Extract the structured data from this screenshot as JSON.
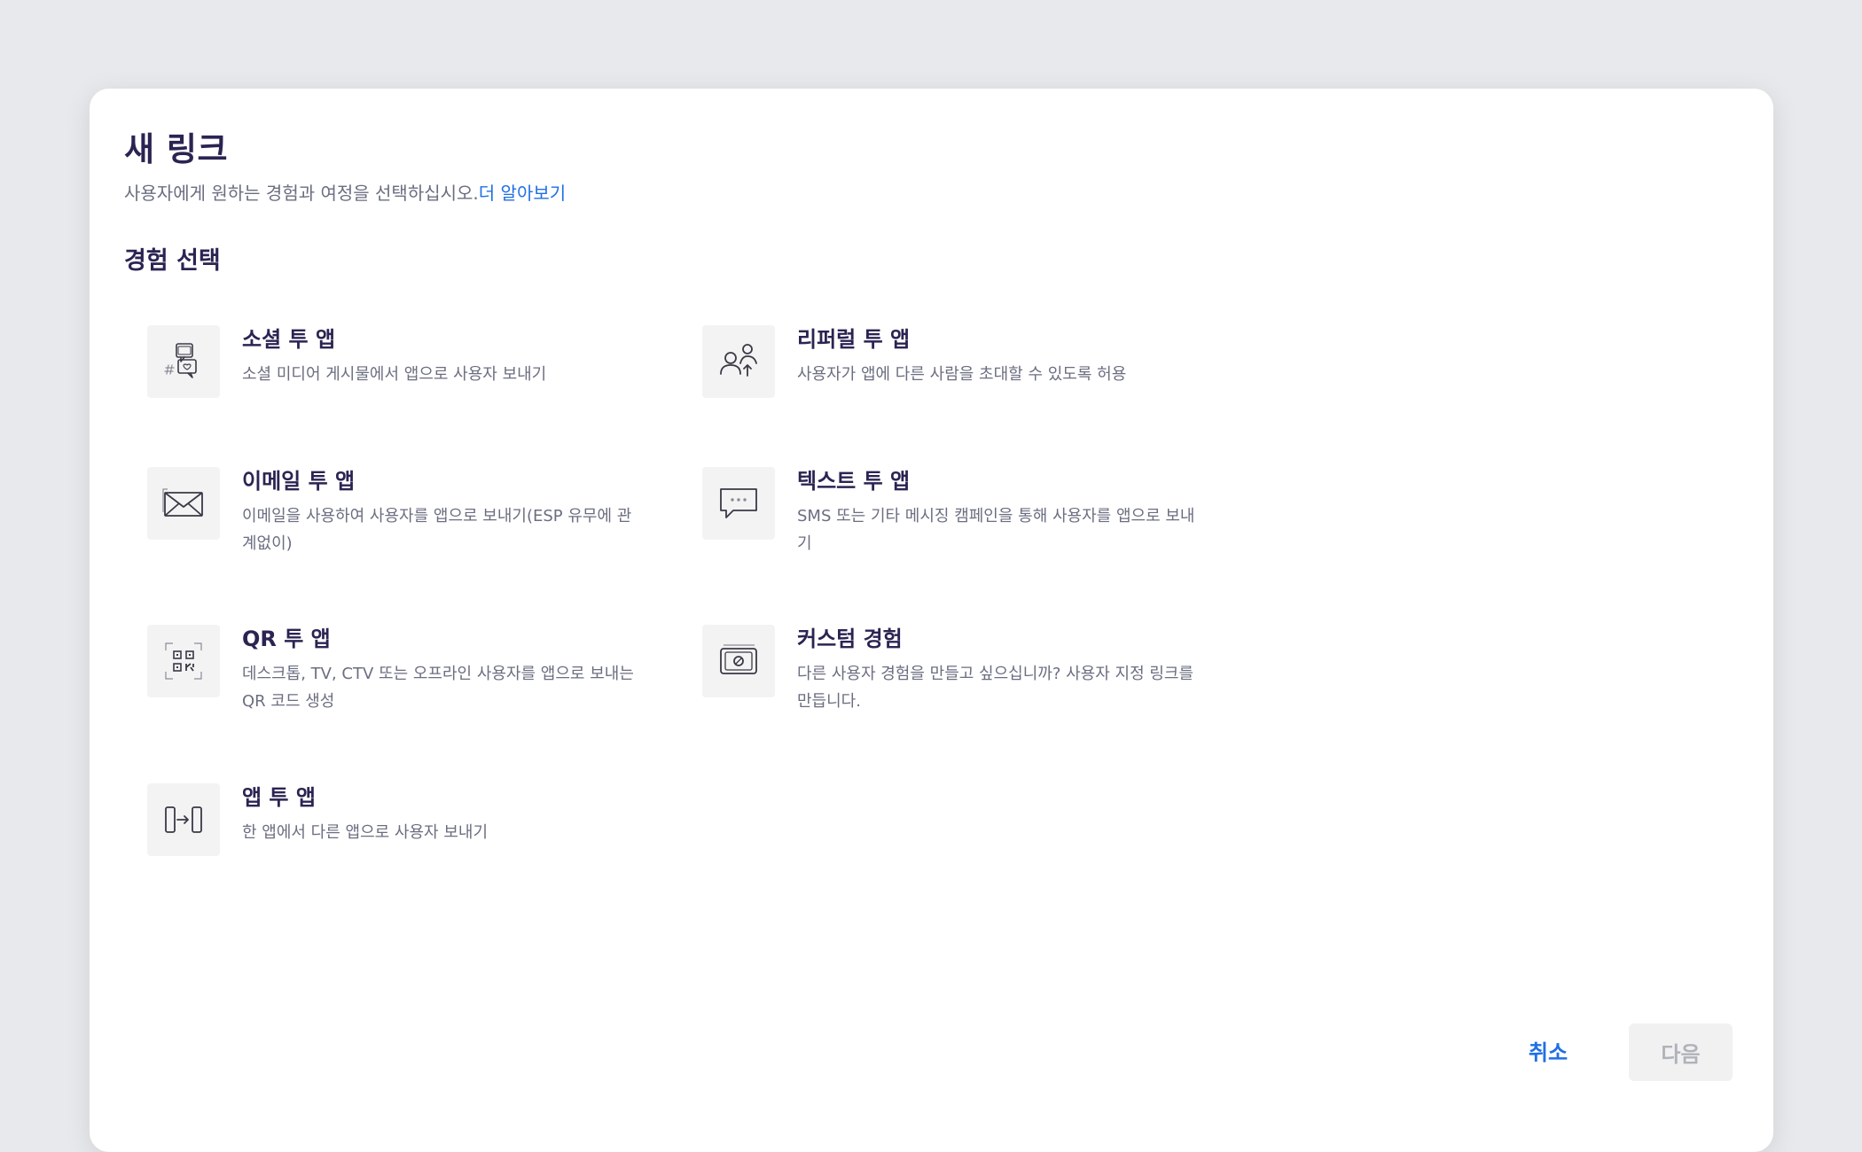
{
  "dialog": {
    "title": "새 링크",
    "subtitle": "사용자에게 원하는 경험과 여정을 선택하십시오.",
    "learn_more": "더 알아보기",
    "section_title": "경험 선택"
  },
  "options": [
    {
      "id": "social",
      "icon": "social-chat-icon",
      "title": "소셜 투 앱",
      "description": "소셜 미디어 게시물에서 앱으로 사용자 보내기"
    },
    {
      "id": "referral",
      "icon": "referral-users-icon",
      "title": "리퍼럴 투 앱",
      "description": "사용자가 앱에 다른 사람을 초대할 수 있도록 허용"
    },
    {
      "id": "email",
      "icon": "envelope-icon",
      "title": "이메일 투 앱",
      "description": "이메일을 사용하여 사용자를 앱으로 보내기(ESP 유무에 관계없이)"
    },
    {
      "id": "text",
      "icon": "speech-bubble-icon",
      "title": "텍스트 투 앱",
      "description": "SMS 또는 기타 메시징 캠페인을 통해 사용자를 앱으로 보내기"
    },
    {
      "id": "qr",
      "icon": "qr-code-icon",
      "title": "QR 투 앱",
      "description": "데스크톱, TV, CTV 또는 오프라인 사용자를 앱으로 보내는 QR 코드 생성"
    },
    {
      "id": "custom",
      "icon": "custom-experience-icon",
      "title": "커스텀 경험",
      "description": "다른 사용자 경험을 만들고 싶으십니까? 사용자 지정 링크를 만듭니다."
    },
    {
      "id": "app",
      "icon": "app-to-app-icon",
      "title": "앱 투 앱",
      "description": "한 앱에서 다른 앱으로 사용자 보내기"
    }
  ],
  "footer": {
    "cancel_label": "취소",
    "next_label": "다음"
  },
  "colors": {
    "background": "#e8e9ec",
    "title": "#2b2452",
    "link": "#1f6fe5",
    "muted_text": "#6b6e80",
    "disabled_button_bg": "#f1f1f2",
    "disabled_button_text": "#b0b2b9"
  }
}
